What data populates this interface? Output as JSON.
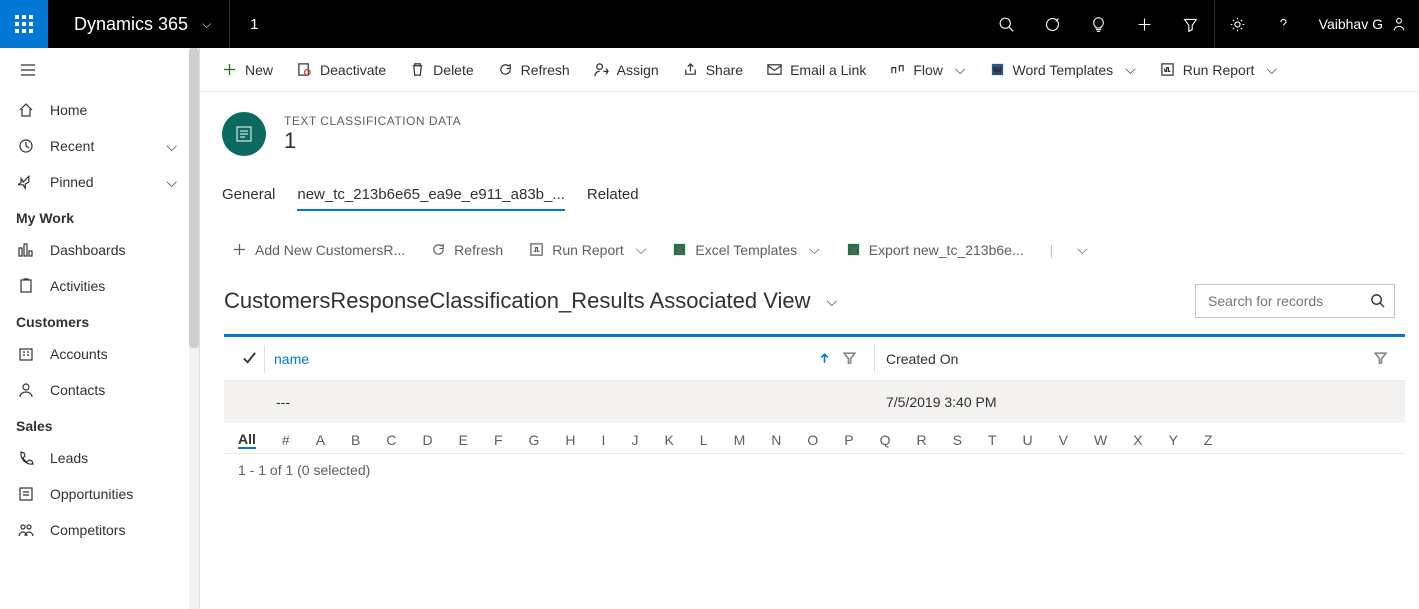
{
  "topbar": {
    "brand": "Dynamics 365",
    "breadcrumb": "1",
    "user": "Vaibhav G"
  },
  "nav": {
    "home": "Home",
    "recent": "Recent",
    "pinned": "Pinned",
    "sections": {
      "mywork": "My Work",
      "customers": "Customers",
      "sales": "Sales"
    },
    "items": {
      "dashboards": "Dashboards",
      "activities": "Activities",
      "accounts": "Accounts",
      "contacts": "Contacts",
      "leads": "Leads",
      "opportunities": "Opportunities",
      "competitors": "Competitors"
    }
  },
  "cmd": {
    "new": "New",
    "deactivate": "Deactivate",
    "delete": "Delete",
    "refresh": "Refresh",
    "assign": "Assign",
    "share": "Share",
    "email": "Email a Link",
    "flow": "Flow",
    "word": "Word Templates",
    "report": "Run Report"
  },
  "record": {
    "type": "TEXT CLASSIFICATION DATA",
    "name": "1"
  },
  "tabs": {
    "general": "General",
    "custom": "new_tc_213b6e65_ea9e_e911_a83b_...",
    "related": "Related"
  },
  "subcmd": {
    "add": "Add New CustomersR...",
    "refresh": "Refresh",
    "report": "Run Report",
    "excel": "Excel Templates",
    "export": "Export new_tc_213b6e..."
  },
  "view": {
    "title": "CustomersResponseClassification_Results Associated View",
    "search_placeholder": "Search for records"
  },
  "grid": {
    "columns": {
      "name": "name",
      "created": "Created On"
    },
    "rows": [
      {
        "name": "---",
        "created": "7/5/2019 3:40 PM"
      }
    ],
    "alpha": [
      "All",
      "#",
      "A",
      "B",
      "C",
      "D",
      "E",
      "F",
      "G",
      "H",
      "I",
      "J",
      "K",
      "L",
      "M",
      "N",
      "O",
      "P",
      "Q",
      "R",
      "S",
      "T",
      "U",
      "V",
      "W",
      "X",
      "Y",
      "Z"
    ],
    "footer": "1 - 1 of 1 (0 selected)"
  }
}
